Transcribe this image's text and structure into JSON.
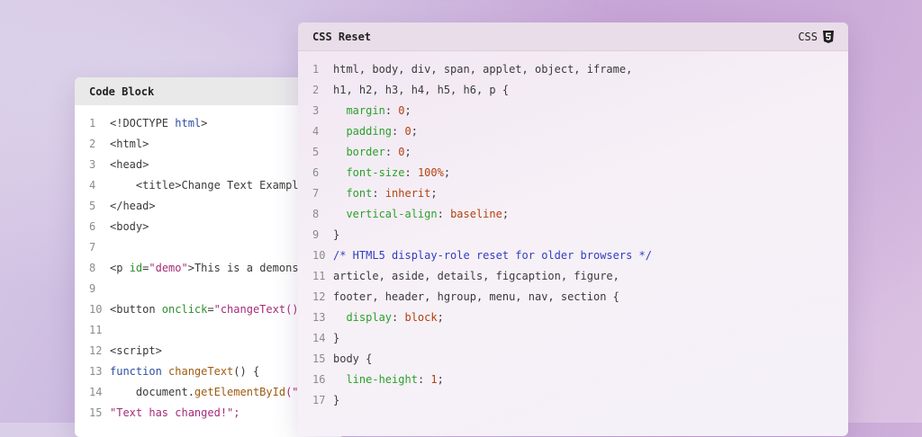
{
  "left_window": {
    "title": "Code Block",
    "lines": [
      {
        "n": "1",
        "segs": [
          {
            "t": "<!DOCTYPE ",
            "c": "plain"
          },
          {
            "t": "html",
            "c": "name"
          },
          {
            "t": ">",
            "c": "plain"
          }
        ]
      },
      {
        "n": "2",
        "segs": [
          {
            "t": "<html>",
            "c": "plain"
          }
        ]
      },
      {
        "n": "3",
        "segs": [
          {
            "t": "<head>",
            "c": "plain"
          }
        ]
      },
      {
        "n": "4",
        "segs": [
          {
            "t": "    <title>Change Text Exampl",
            "c": "plain"
          }
        ]
      },
      {
        "n": "5",
        "segs": [
          {
            "t": "</head>",
            "c": "plain"
          }
        ]
      },
      {
        "n": "6",
        "segs": [
          {
            "t": "<body>",
            "c": "plain"
          }
        ]
      },
      {
        "n": "7",
        "segs": []
      },
      {
        "n": "8",
        "segs": [
          {
            "t": "<p ",
            "c": "plain"
          },
          {
            "t": "id",
            "c": "attr"
          },
          {
            "t": "=",
            "c": "plain"
          },
          {
            "t": "\"demo\"",
            "c": "str"
          },
          {
            "t": ">This is a demons",
            "c": "plain"
          }
        ]
      },
      {
        "n": "9",
        "segs": []
      },
      {
        "n": "10",
        "segs": [
          {
            "t": "<button ",
            "c": "plain"
          },
          {
            "t": "onclick",
            "c": "attr"
          },
          {
            "t": "=",
            "c": "plain"
          },
          {
            "t": "\"changeText()",
            "c": "str"
          }
        ]
      },
      {
        "n": "11",
        "segs": []
      },
      {
        "n": "12",
        "segs": [
          {
            "t": "<script>",
            "c": "plain"
          }
        ]
      },
      {
        "n": "13",
        "segs": [
          {
            "t": "function ",
            "c": "kw"
          },
          {
            "t": "changeText",
            "c": "fn"
          },
          {
            "t": "() {",
            "c": "plain"
          }
        ]
      },
      {
        "n": "14",
        "segs": [
          {
            "t": "    document.",
            "c": "plain"
          },
          {
            "t": "getElementById",
            "c": "fn"
          },
          {
            "t": "(\"",
            "c": "str"
          }
        ]
      },
      {
        "n": "15",
        "segs": [
          {
            "t": "\"Text has changed!\";",
            "c": "str"
          }
        ]
      }
    ]
  },
  "right_window": {
    "title": "CSS Reset",
    "language": "CSS",
    "language_icon": "css3-icon",
    "lines": [
      {
        "n": "1",
        "segs": [
          {
            "t": "html, body, div, span, applet, object, iframe,",
            "c": "plain"
          }
        ]
      },
      {
        "n": "2",
        "segs": [
          {
            "t": "h1, h2, h3, h4, h5, h6, p {",
            "c": "plain"
          }
        ]
      },
      {
        "n": "3",
        "segs": [
          {
            "t": "  ",
            "c": "plain"
          },
          {
            "t": "margin",
            "c": "prop"
          },
          {
            "t": ": ",
            "c": "plain"
          },
          {
            "t": "0",
            "c": "val"
          },
          {
            "t": ";",
            "c": "plain"
          }
        ]
      },
      {
        "n": "4",
        "segs": [
          {
            "t": "  ",
            "c": "plain"
          },
          {
            "t": "padding",
            "c": "prop"
          },
          {
            "t": ": ",
            "c": "plain"
          },
          {
            "t": "0",
            "c": "val"
          },
          {
            "t": ";",
            "c": "plain"
          }
        ]
      },
      {
        "n": "5",
        "segs": [
          {
            "t": "  ",
            "c": "plain"
          },
          {
            "t": "border",
            "c": "prop"
          },
          {
            "t": ": ",
            "c": "plain"
          },
          {
            "t": "0",
            "c": "val"
          },
          {
            "t": ";",
            "c": "plain"
          }
        ]
      },
      {
        "n": "6",
        "segs": [
          {
            "t": "  ",
            "c": "plain"
          },
          {
            "t": "font-size",
            "c": "prop"
          },
          {
            "t": ": ",
            "c": "plain"
          },
          {
            "t": "100%",
            "c": "val"
          },
          {
            "t": ";",
            "c": "plain"
          }
        ]
      },
      {
        "n": "7",
        "segs": [
          {
            "t": "  ",
            "c": "plain"
          },
          {
            "t": "font",
            "c": "prop"
          },
          {
            "t": ": ",
            "c": "plain"
          },
          {
            "t": "inherit",
            "c": "val"
          },
          {
            "t": ";",
            "c": "plain"
          }
        ]
      },
      {
        "n": "8",
        "segs": [
          {
            "t": "  ",
            "c": "plain"
          },
          {
            "t": "vertical-align",
            "c": "prop"
          },
          {
            "t": ": ",
            "c": "plain"
          },
          {
            "t": "baseline",
            "c": "val"
          },
          {
            "t": ";",
            "c": "plain"
          }
        ]
      },
      {
        "n": "9",
        "segs": [
          {
            "t": "}",
            "c": "plain"
          }
        ]
      },
      {
        "n": "10",
        "segs": [
          {
            "t": "/* HTML5 display-role reset for older browsers */",
            "c": "cm"
          }
        ]
      },
      {
        "n": "11",
        "segs": [
          {
            "t": "article, aside, details, figcaption, figure,",
            "c": "plain"
          }
        ]
      },
      {
        "n": "12",
        "segs": [
          {
            "t": "footer, header, hgroup, menu, nav, section {",
            "c": "plain"
          }
        ]
      },
      {
        "n": "13",
        "segs": [
          {
            "t": "  ",
            "c": "plain"
          },
          {
            "t": "display",
            "c": "prop"
          },
          {
            "t": ": ",
            "c": "plain"
          },
          {
            "t": "block",
            "c": "val"
          },
          {
            "t": ";",
            "c": "plain"
          }
        ]
      },
      {
        "n": "14",
        "segs": [
          {
            "t": "}",
            "c": "plain"
          }
        ]
      },
      {
        "n": "15",
        "segs": [
          {
            "t": "body {",
            "c": "plain"
          }
        ]
      },
      {
        "n": "16",
        "segs": [
          {
            "t": "  ",
            "c": "plain"
          },
          {
            "t": "line-height",
            "c": "prop"
          },
          {
            "t": ": ",
            "c": "plain"
          },
          {
            "t": "1",
            "c": "val"
          },
          {
            "t": ";",
            "c": "plain"
          }
        ]
      },
      {
        "n": "17",
        "segs": [
          {
            "t": "}",
            "c": "plain"
          }
        ]
      }
    ]
  }
}
